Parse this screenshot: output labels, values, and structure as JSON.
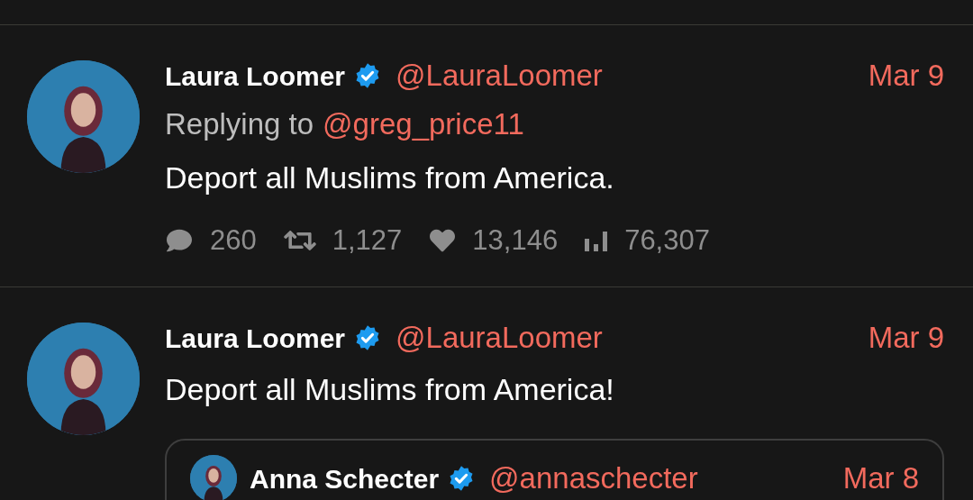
{
  "tweets": [
    {
      "author": {
        "name": "Laura Loomer",
        "verified": true,
        "handle": "@LauraLoomer"
      },
      "date": "Mar 9",
      "replying_to": {
        "label": "Replying to",
        "handle": "@greg_price11"
      },
      "text": "Deport all Muslims from America.",
      "stats": [
        {
          "kind": "replies",
          "value": "260"
        },
        {
          "kind": "retweets",
          "value": "1,127"
        },
        {
          "kind": "likes",
          "value": "13,146"
        },
        {
          "kind": "views",
          "value": "76,307"
        }
      ]
    },
    {
      "author": {
        "name": "Laura Loomer",
        "verified": true,
        "handle": "@LauraLoomer"
      },
      "date": "Mar 9",
      "text": "Deport all Muslims from America!",
      "quoted": {
        "author": {
          "name": "Anna Schecter",
          "verified": true,
          "handle": "@annaschecter"
        },
        "date": "Mar 8"
      }
    }
  ]
}
